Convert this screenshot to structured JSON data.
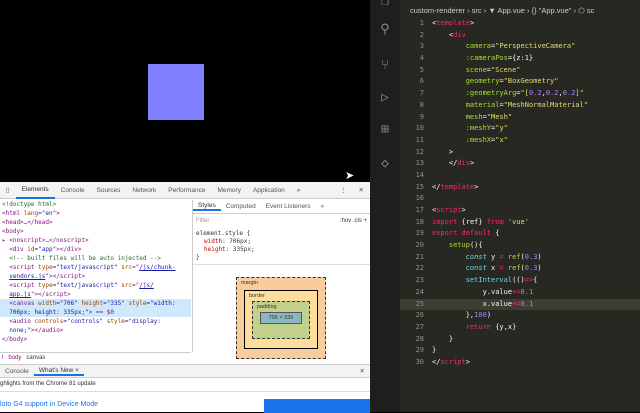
{
  "devtools": {
    "tabs": [
      "Elements",
      "Console",
      "Sources",
      "Network",
      "Performance",
      "Memory",
      "Application",
      "»"
    ],
    "more": "⋮",
    "close": "✕",
    "elements": [
      [
        [
          "<!doctype html>",
          "cm"
        ]
      ],
      [
        [
          "<html ",
          ""
        ],
        [
          "lang",
          "attr"
        ],
        [
          "=\"en\"",
          "val"
        ],
        [
          ">",
          ""
        ]
      ],
      [
        [
          "<head>…</head>",
          ""
        ]
      ],
      [
        [
          "<body>",
          ""
        ]
      ],
      [
        [
          "▸ <noscript>…</noscript>",
          ""
        ]
      ],
      [
        [
          "  <div ",
          ""
        ],
        [
          "id",
          "attr"
        ],
        [
          "=\"app\"",
          "val"
        ],
        [
          "></div>",
          ""
        ]
      ],
      [
        [
          "  <!-- built files will be auto injected -->",
          "cm"
        ]
      ],
      [
        [
          "  <script ",
          ""
        ],
        [
          "type",
          "attr"
        ],
        [
          "=\"text/javascript\" ",
          "val"
        ],
        [
          "src",
          "attr"
        ],
        [
          "=\"",
          ""
        ],
        [
          "/js/chunk-",
          "lnk"
        ]
      ],
      [
        [
          "  ",
          ""
        ],
        [
          "vendors.js",
          "lnk"
        ],
        [
          "\"></script>",
          ""
        ]
      ],
      [
        [
          "  <script ",
          ""
        ],
        [
          "type",
          "attr"
        ],
        [
          "=\"text/javascript\" ",
          "val"
        ],
        [
          "src",
          "attr"
        ],
        [
          "=\"",
          ""
        ],
        [
          "/js/",
          "lnk"
        ]
      ],
      [
        [
          "  ",
          ""
        ],
        [
          "app.js",
          "lnk"
        ],
        [
          "\"></script>",
          ""
        ]
      ],
      [
        [
          "  <canvas ",
          ""
        ],
        [
          "width",
          "attr"
        ],
        [
          "=\"706\" ",
          "val"
        ],
        [
          "height",
          "attr"
        ],
        [
          "=\"335\" ",
          "val"
        ],
        [
          "style",
          "attr"
        ],
        [
          "=\"width:",
          "val"
        ]
      ],
      [
        [
          "  706px; height: 335px;\"",
          "val"
        ],
        [
          "> == $0",
          ""
        ]
      ],
      [
        [
          "  <audio ",
          ""
        ],
        [
          "controls",
          "attr"
        ],
        [
          "=\"controls\" ",
          "val"
        ],
        [
          "style",
          "attr"
        ],
        [
          "=\"display:",
          "val"
        ]
      ],
      [
        [
          "  none;\"",
          "val"
        ],
        [
          "></audio>",
          ""
        ]
      ],
      [
        [
          "</body>",
          ""
        ]
      ]
    ],
    "styles_tabs": [
      "Styles",
      "Computed",
      "Event Listeners",
      "»"
    ],
    "filter_placeholder": "Filter",
    "hov": ":hov",
    "cls": ".cls",
    "plus": "+",
    "element_style": "element.style {",
    "width_prop": "width",
    "width_val": "706px;",
    "height_prop": "height",
    "height_val": "335px;",
    "close_brace": "}",
    "box": {
      "margin": "margin",
      "border": "border",
      "padding": "padding",
      "content": "706 × 335",
      "dash": "-"
    },
    "breadcrumb": [
      "l",
      "body",
      "canvas"
    ],
    "drawer_tabs": [
      "Console",
      "What's New ×"
    ],
    "drawer_close": "✕",
    "news_header": "ghlights from the Chrome 81 update",
    "news_item": "loto G4 support in Device Mode"
  },
  "vscode": {
    "breadcrumb": "custom-renderer › src › ▼ App.vue › {} \"App.vue\" › ⬡ sc",
    "active_line": 25,
    "code": [
      [
        [
          "<",
          "p"
        ],
        [
          "template",
          "t"
        ],
        [
          ">",
          "p"
        ]
      ],
      [
        [
          "    <",
          "p"
        ],
        [
          "div",
          "t"
        ]
      ],
      [
        [
          "        camera",
          "a"
        ],
        [
          "=",
          "p"
        ],
        [
          "\"PerspectiveCamera\"",
          "s"
        ]
      ],
      [
        [
          "        :cameraPos",
          "a"
        ],
        [
          "=",
          "p"
        ],
        [
          "{z:1}",
          "p"
        ]
      ],
      [
        [
          "        scene",
          "a"
        ],
        [
          "=",
          "p"
        ],
        [
          "\"Scene\"",
          "s"
        ]
      ],
      [
        [
          "        geometry",
          "a"
        ],
        [
          "=",
          "p"
        ],
        [
          "\"BoxGeometry\"",
          "s"
        ]
      ],
      [
        [
          "        :geometryArg",
          "a"
        ],
        [
          "=",
          "p"
        ],
        [
          "\"[",
          "s"
        ],
        [
          "0.2",
          "n"
        ],
        [
          ",",
          "p"
        ],
        [
          "0.2",
          "n"
        ],
        [
          ",",
          "p"
        ],
        [
          "0.2",
          "n"
        ],
        [
          "]\"",
          "s"
        ]
      ],
      [
        [
          "        material",
          "a"
        ],
        [
          "=",
          "p"
        ],
        [
          "\"MeshNormalMaterial\"",
          "s"
        ]
      ],
      [
        [
          "        mesh",
          "a"
        ],
        [
          "=",
          "p"
        ],
        [
          "\"Mesh\"",
          "s"
        ]
      ],
      [
        [
          "        :meshY",
          "a"
        ],
        [
          "=",
          "p"
        ],
        [
          "\"y\"",
          "s"
        ]
      ],
      [
        [
          "        :meshX",
          "a"
        ],
        [
          "=",
          "p"
        ],
        [
          "\"x\"",
          "s"
        ]
      ],
      [
        [
          "    >",
          "p"
        ]
      ],
      [
        [
          "    </",
          "p"
        ],
        [
          "div",
          "t"
        ],
        [
          ">",
          "p"
        ]
      ],
      [
        [
          "",
          ""
        ]
      ],
      [
        [
          "</",
          "p"
        ],
        [
          "template",
          "t"
        ],
        [
          ">",
          "p"
        ]
      ],
      [
        [
          "",
          ""
        ]
      ],
      [
        [
          "<",
          "p"
        ],
        [
          "script",
          "t"
        ],
        [
          ">",
          "p"
        ]
      ],
      [
        [
          "import ",
          "kw"
        ],
        [
          "{ref} ",
          "p"
        ],
        [
          "from ",
          "kw"
        ],
        [
          "'vue'",
          "s"
        ]
      ],
      [
        [
          "export default ",
          "kw"
        ],
        [
          "{",
          "p"
        ]
      ],
      [
        [
          "    setup",
          "f"
        ],
        [
          "(){",
          "p"
        ]
      ],
      [
        [
          "        const ",
          "k"
        ],
        [
          "y ",
          "p"
        ],
        [
          "= ",
          "kw"
        ],
        [
          "ref",
          "f"
        ],
        [
          "(",
          "p"
        ],
        [
          "0.3",
          "n"
        ],
        [
          ")",
          "p"
        ]
      ],
      [
        [
          "        const ",
          "k"
        ],
        [
          "x ",
          "p"
        ],
        [
          "= ",
          "kw"
        ],
        [
          "ref",
          "f"
        ],
        [
          "(",
          "p"
        ],
        [
          "0.3",
          "n"
        ],
        [
          ")",
          "p"
        ]
      ],
      [
        [
          "        setInterval",
          "b"
        ],
        [
          "(()",
          "p"
        ],
        [
          "=>",
          "kw"
        ],
        [
          "{",
          "p"
        ]
      ],
      [
        [
          "            y.value",
          "p"
        ],
        [
          "+=",
          "kw"
        ],
        [
          "0.1",
          "n"
        ]
      ],
      [
        [
          "            x.value",
          "p"
        ],
        [
          "+=",
          "kw"
        ],
        [
          "0.1",
          "n"
        ]
      ],
      [
        [
          "        },",
          "p"
        ],
        [
          "100",
          "n"
        ],
        [
          ")",
          "p"
        ]
      ],
      [
        [
          "        return ",
          "kw"
        ],
        [
          "{y,x}",
          "p"
        ]
      ],
      [
        [
          "    }",
          "p"
        ]
      ],
      [
        [
          "}",
          "p"
        ]
      ],
      [
        [
          "</",
          "p"
        ],
        [
          "script",
          "t"
        ],
        [
          ">",
          "p"
        ]
      ]
    ]
  },
  "colors": {
    "cube": "#8080ff",
    "editor_bg": "#272822"
  }
}
